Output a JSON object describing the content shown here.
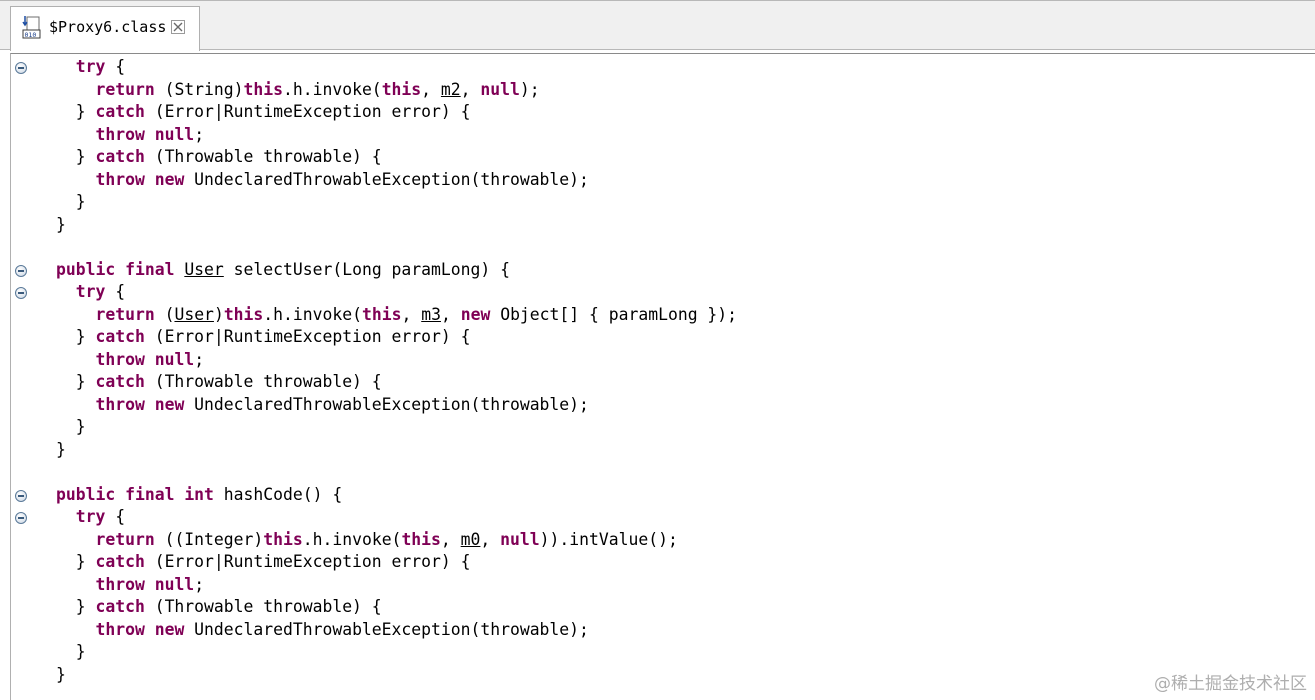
{
  "tab": {
    "title": "$Proxy6.class",
    "icon": "class-file-icon",
    "close_icon": "close-icon"
  },
  "code": {
    "lines": [
      [
        "  ",
        "kw:try",
        " {"
      ],
      [
        "    ",
        "kw:return",
        " (String)",
        "kw:this",
        ".h.invoke(",
        "kw:this",
        ", ",
        "ul:m2",
        ", ",
        "kw:null",
        ");"
      ],
      [
        "  } ",
        "kw:catch",
        " (Error|RuntimeException error) {"
      ],
      [
        "    ",
        "kw:throw",
        " ",
        "kw:null",
        ";"
      ],
      [
        "  } ",
        "kw:catch",
        " (Throwable throwable) {"
      ],
      [
        "    ",
        "kw:throw",
        " ",
        "kw:new",
        " UndeclaredThrowableException(throwable);"
      ],
      [
        "  }"
      ],
      [
        "}"
      ],
      [
        ""
      ],
      [
        "kw:public",
        " ",
        "kw:final",
        " ",
        "ul:User",
        " selectUser(Long paramLong) {"
      ],
      [
        "  ",
        "kw:try",
        " {"
      ],
      [
        "    ",
        "kw:return",
        " (",
        "ul:User",
        ")",
        "kw:this",
        ".h.invoke(",
        "kw:this",
        ", ",
        "ul:m3",
        ", ",
        "kw:new",
        " Object[] { paramLong });"
      ],
      [
        "  } ",
        "kw:catch",
        " (Error|RuntimeException error) {"
      ],
      [
        "    ",
        "kw:throw",
        " ",
        "kw:null",
        ";"
      ],
      [
        "  } ",
        "kw:catch",
        " (Throwable throwable) {"
      ],
      [
        "    ",
        "kw:throw",
        " ",
        "kw:new",
        " UndeclaredThrowableException(throwable);"
      ],
      [
        "  }"
      ],
      [
        "}"
      ],
      [
        ""
      ],
      [
        "kw:public",
        " ",
        "kw:final",
        " ",
        "kw:int",
        " hashCode() {"
      ],
      [
        "  ",
        "kw:try",
        " {"
      ],
      [
        "    ",
        "kw:return",
        " ((Integer)",
        "kw:this",
        ".h.invoke(",
        "kw:this",
        ", ",
        "ul:m0",
        ", ",
        "kw:null",
        ")).intValue();"
      ],
      [
        "  } ",
        "kw:catch",
        " (Error|RuntimeException error) {"
      ],
      [
        "    ",
        "kw:throw",
        " ",
        "kw:null",
        ";"
      ],
      [
        "  } ",
        "kw:catch",
        " (Throwable throwable) {"
      ],
      [
        "    ",
        "kw:throw",
        " ",
        "kw:new",
        " UndeclaredThrowableException(throwable);"
      ],
      [
        "  }"
      ],
      [
        "}"
      ]
    ],
    "fold_lines": [
      0,
      9,
      10,
      19,
      20
    ]
  },
  "colors": {
    "keyword": "#7f0055",
    "text": "#000000",
    "fold_border": "#5b7a99"
  },
  "watermark": "@稀土掘金技术社区"
}
